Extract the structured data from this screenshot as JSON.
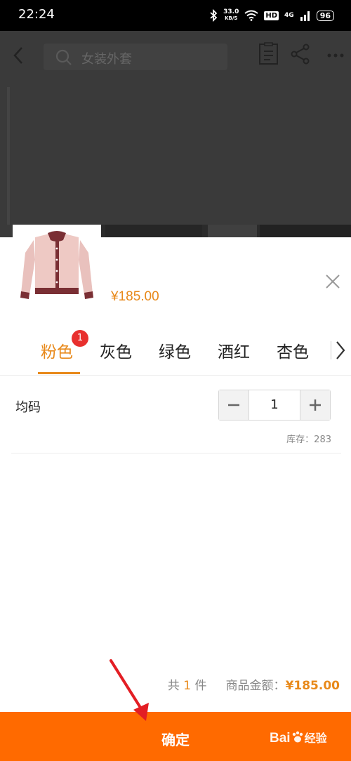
{
  "status_bar": {
    "time": "22:24",
    "net_speed_value": "33.0",
    "net_speed_unit": "KB/S",
    "hd": "HD",
    "signal": "4G",
    "battery": "96"
  },
  "background_page": {
    "search_placeholder": "女装外套"
  },
  "product": {
    "price": "¥185.00"
  },
  "color_tabs": {
    "items": [
      "粉色",
      "灰色",
      "绿色",
      "酒红",
      "杏色"
    ],
    "active_index": 0,
    "badge": "1"
  },
  "size": {
    "label": "均码",
    "quantity": "1",
    "stock_text": "库存：283"
  },
  "summary": {
    "prefix": "共",
    "count": "1",
    "unit": "件",
    "amount_label": "商品金额：",
    "amount": "¥185.00"
  },
  "confirm": {
    "label": "确定"
  },
  "watermark": {
    "brand": "Bai",
    "cn": "经验"
  },
  "colors": {
    "accent": "#e8891a",
    "confirm_bg": "#ff6a00",
    "badge_red": "#e8302e"
  }
}
